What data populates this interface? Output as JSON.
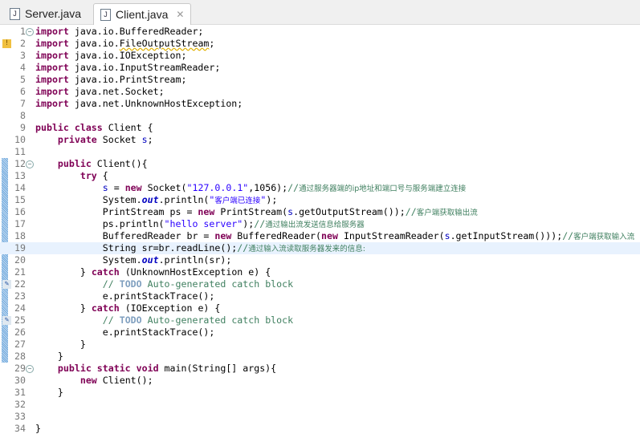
{
  "tabs": [
    {
      "label": "Server.java",
      "active": false
    },
    {
      "label": "Client.java",
      "active": true,
      "close": "✕"
    }
  ],
  "current_line": 19,
  "fold_lines": [
    1,
    12,
    29
  ],
  "lines": [
    [
      [
        "kw",
        "import"
      ],
      [
        "p",
        " java.io.BufferedReader;"
      ]
    ],
    [
      [
        "kw",
        "import"
      ],
      [
        "p",
        " java.io."
      ],
      [
        "w",
        "FileOutputStream"
      ],
      [
        "p",
        ";"
      ]
    ],
    [
      [
        "kw",
        "import"
      ],
      [
        "p",
        " java.io.IOException;"
      ]
    ],
    [
      [
        "kw",
        "import"
      ],
      [
        "p",
        " java.io.InputStreamReader;"
      ]
    ],
    [
      [
        "kw",
        "import"
      ],
      [
        "p",
        " java.io.PrintStream;"
      ]
    ],
    [
      [
        "kw",
        "import"
      ],
      [
        "p",
        " java.net.Socket;"
      ]
    ],
    [
      [
        "kw",
        "import"
      ],
      [
        "p",
        " java.net.UnknownHostException;"
      ]
    ],
    [],
    [
      [
        "kw",
        "public class"
      ],
      [
        "p",
        " Client {"
      ]
    ],
    [
      [
        "p",
        "    "
      ],
      [
        "kw",
        "private"
      ],
      [
        "p",
        " Socket "
      ],
      [
        "fld",
        "s"
      ],
      [
        "p",
        ";"
      ]
    ],
    [],
    [
      [
        "p",
        "    "
      ],
      [
        "kw",
        "public"
      ],
      [
        "p",
        " Client(){"
      ]
    ],
    [
      [
        "p",
        "        "
      ],
      [
        "kw",
        "try"
      ],
      [
        "p",
        " {"
      ]
    ],
    [
      [
        "p",
        "            "
      ],
      [
        "fld",
        "s"
      ],
      [
        "p",
        " = "
      ],
      [
        "kw",
        "new"
      ],
      [
        "p",
        " Socket("
      ],
      [
        "str",
        "\"127.0.0.1\""
      ],
      [
        "p",
        ",1056);"
      ],
      [
        "cm",
        "//"
      ],
      [
        "cmz",
        "通过服务器端的ip地址和端口号与服务端建立连接"
      ]
    ],
    [
      [
        "p",
        "            System."
      ],
      [
        "sfld",
        "out"
      ],
      [
        "p",
        ".println("
      ],
      [
        "str",
        "\""
      ],
      [
        "cmzs",
        "客户端已连接"
      ],
      [
        "str",
        "\""
      ],
      [
        "p",
        ");"
      ]
    ],
    [
      [
        "p",
        "            PrintStream ps = "
      ],
      [
        "kw",
        "new"
      ],
      [
        "p",
        " PrintStream("
      ],
      [
        "fld",
        "s"
      ],
      [
        "p",
        ".getOutputStream());"
      ],
      [
        "cm",
        "//"
      ],
      [
        "cmz",
        "客户端获取输出流"
      ]
    ],
    [
      [
        "p",
        "            ps.println("
      ],
      [
        "str",
        "\"hello server\""
      ],
      [
        "p",
        ");"
      ],
      [
        "cm",
        "//"
      ],
      [
        "cmz",
        "通过输出流发送信息给服务器"
      ]
    ],
    [
      [
        "p",
        "            BufferedReader br = "
      ],
      [
        "kw",
        "new"
      ],
      [
        "p",
        " BufferedReader("
      ],
      [
        "kw",
        "new"
      ],
      [
        "p",
        " InputStreamReader("
      ],
      [
        "fld",
        "s"
      ],
      [
        "p",
        ".getInputStream()));"
      ],
      [
        "cm",
        "//"
      ],
      [
        "cmz",
        "客户端获取输入流"
      ]
    ],
    [
      [
        "p",
        "            String sr=br.readLine();"
      ],
      [
        "cm",
        "//"
      ],
      [
        "cmz",
        "通过输入流读取服务器发来的信息:"
      ]
    ],
    [
      [
        "p",
        "            System."
      ],
      [
        "sfld",
        "out"
      ],
      [
        "p",
        ".println(sr);"
      ]
    ],
    [
      [
        "p",
        "        } "
      ],
      [
        "kw",
        "catch"
      ],
      [
        "p",
        " (UnknownHostException e) {"
      ]
    ],
    [
      [
        "p",
        "            "
      ],
      [
        "cm",
        "// "
      ],
      [
        "todo",
        "TODO"
      ],
      [
        "cm",
        " Auto-generated catch block"
      ]
    ],
    [
      [
        "p",
        "            e.printStackTrace();"
      ]
    ],
    [
      [
        "p",
        "        } "
      ],
      [
        "kw",
        "catch"
      ],
      [
        "p",
        " (IOException e) {"
      ]
    ],
    [
      [
        "p",
        "            "
      ],
      [
        "cm",
        "// "
      ],
      [
        "todo",
        "TODO"
      ],
      [
        "cm",
        " Auto-generated catch block"
      ]
    ],
    [
      [
        "p",
        "            e.printStackTrace();"
      ]
    ],
    [
      [
        "p",
        "        }"
      ]
    ],
    [
      [
        "p",
        "    }"
      ]
    ],
    [
      [
        "p",
        "    "
      ],
      [
        "kw",
        "public static void"
      ],
      [
        "p",
        " main(String[] args){"
      ]
    ],
    [
      [
        "p",
        "        "
      ],
      [
        "kw",
        "new"
      ],
      [
        "p",
        " Client();"
      ]
    ],
    [
      [
        "p",
        "    }"
      ]
    ],
    [],
    [],
    [
      [
        "p",
        "}"
      ]
    ]
  ],
  "markers": {
    "2": "warning-icon",
    "22": "task-icon",
    "25": "task-icon"
  },
  "colors": {
    "keyword": "#7f0055",
    "string": "#2a00ff",
    "comment": "#3f7f5f",
    "field": "#0000c0",
    "current_line": "#e8f2fe"
  }
}
